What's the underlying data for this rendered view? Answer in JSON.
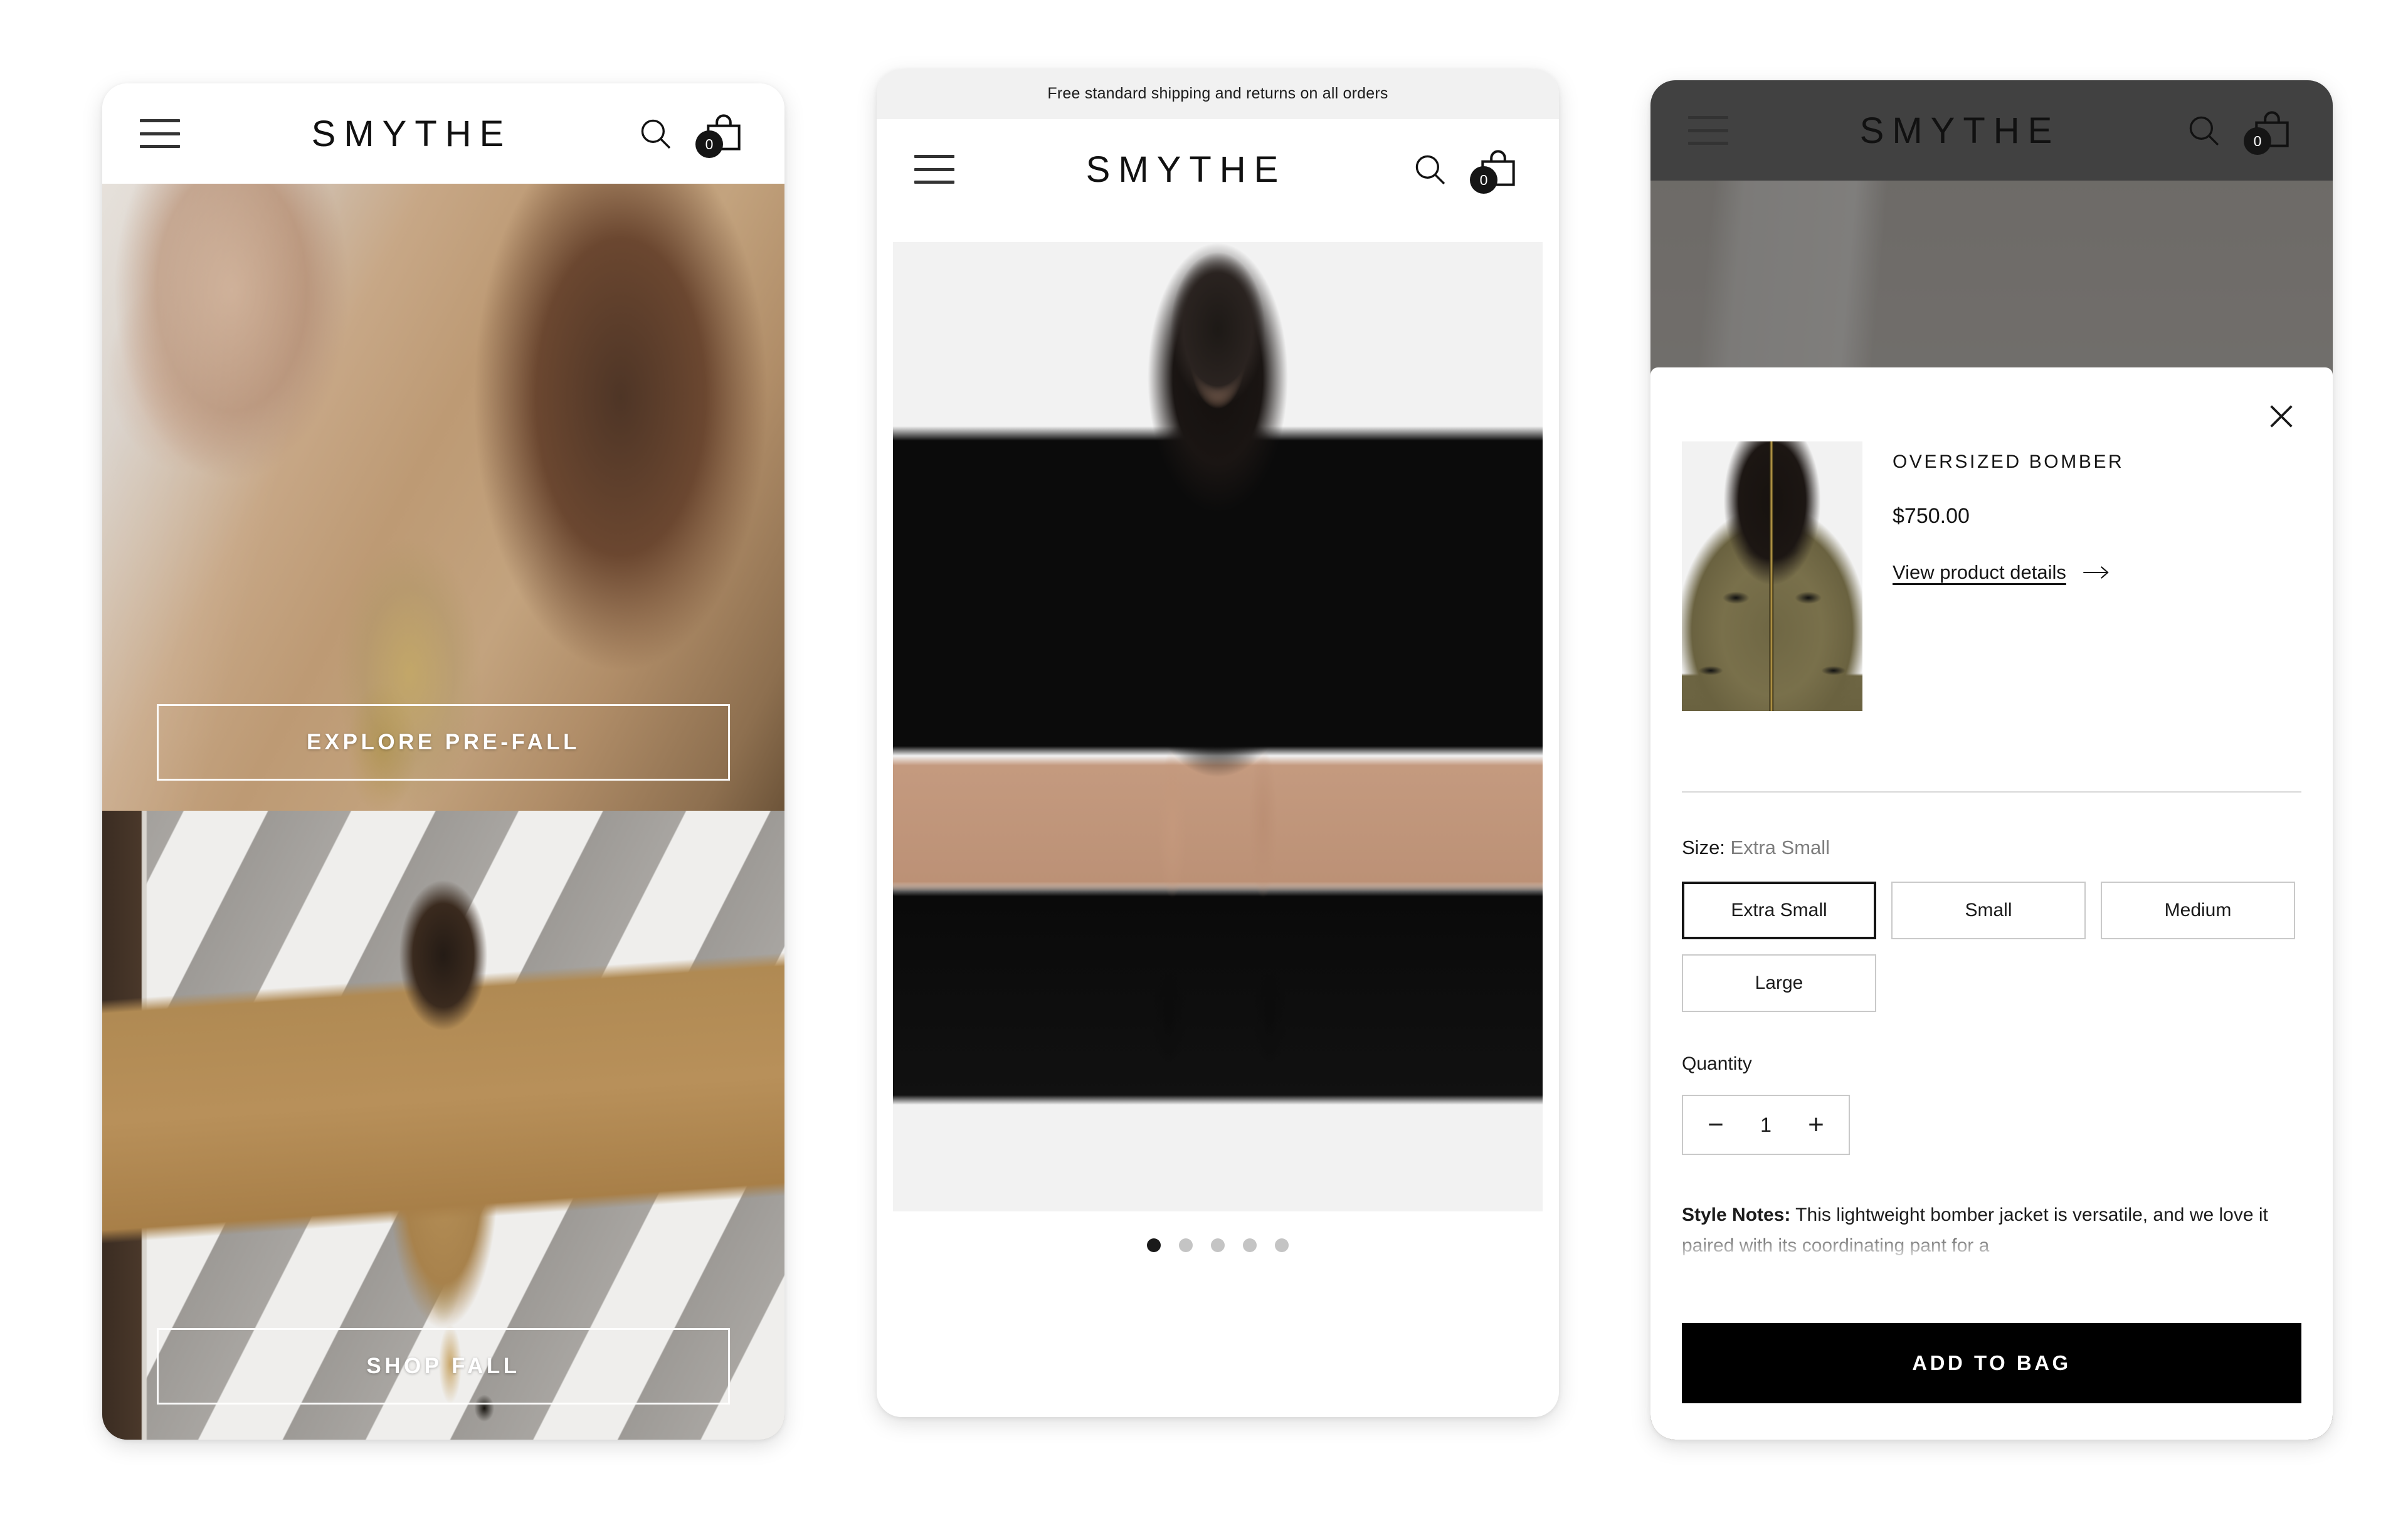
{
  "brand": "SMYTHE",
  "header": {
    "menu_icon": "hamburger-menu-icon",
    "search_icon": "search-icon",
    "cart_icon": "shopping-bag-icon",
    "cart_count": "0"
  },
  "home": {
    "heroes": [
      {
        "image_alt": "camel-coat-closeup",
        "cta": "EXPLORE PRE-FALL"
      },
      {
        "image_alt": "model-crosswalk",
        "cta": "SHOP FALL"
      }
    ]
  },
  "pdp": {
    "announcement": "Free standard shipping and returns on all orders",
    "gallery_image_alt": "model-black-blazer-romper",
    "carousel": {
      "total": 5,
      "active_index": 0
    }
  },
  "modal": {
    "close_icon": "close-icon",
    "thumbnail_alt": "olive-oversized-bomber",
    "product_title": "OVERSIZED BOMBER",
    "price": "$750.00",
    "details_link": "View product details",
    "details_arrow": "arrow-right-icon",
    "size_label_prefix": "Size:",
    "size_selected": "Extra Small",
    "sizes": [
      "Extra Small",
      "Small",
      "Medium",
      "Large"
    ],
    "quantity_label": "Quantity",
    "quantity_value": "1",
    "quantity_decrease": "−",
    "quantity_increase": "+",
    "style_notes_label": "Style Notes:",
    "style_notes_text": " This lightweight bomber jacket is versatile, and we love it paired with its coordinating pant for a",
    "add_to_bag": "ADD TO BAG"
  },
  "colors": {
    "accent": "#000000",
    "announcement_bg": "#f1f1f1",
    "gallery_bg": "#f2f2f2",
    "chip_border": "#c9c9c9",
    "chip_selected_border": "#151515",
    "dot_inactive": "#c4c4c4",
    "dot_active": "#1a1a1a"
  }
}
